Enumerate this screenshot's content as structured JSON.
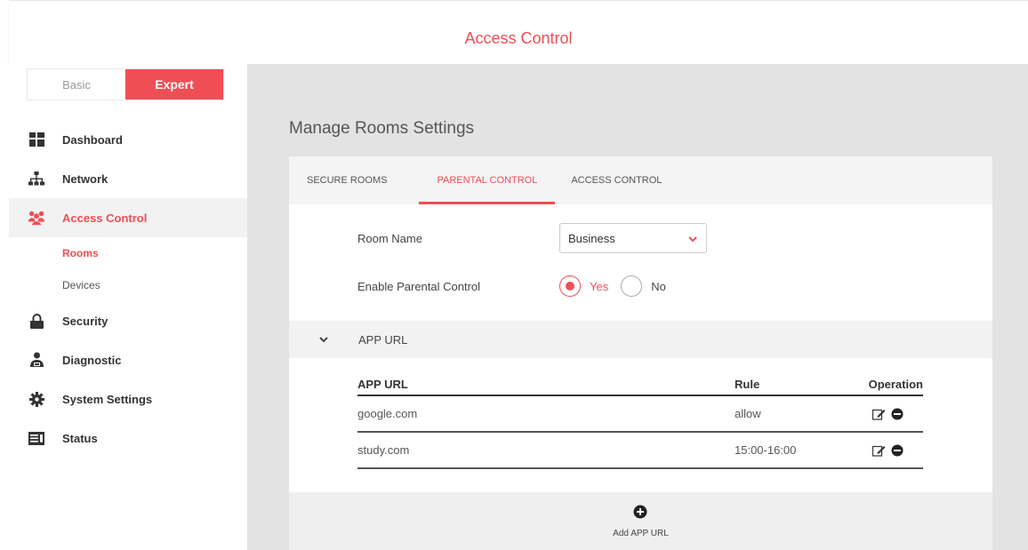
{
  "header": {
    "title": "Access Control"
  },
  "mode_toggle": {
    "basic": "Basic",
    "expert": "Expert",
    "active": "expert"
  },
  "nav": {
    "items": [
      {
        "label": "Dashboard",
        "icon": "dashboard-icon"
      },
      {
        "label": "Network",
        "icon": "network-icon"
      },
      {
        "label": "Access Control",
        "icon": "users-icon",
        "active": true
      },
      {
        "label": "Security",
        "icon": "lock-icon"
      },
      {
        "label": "Diagnostic",
        "icon": "diagnostic-icon"
      },
      {
        "label": "System Settings",
        "icon": "gear-icon"
      },
      {
        "label": "Status",
        "icon": "status-icon"
      }
    ],
    "subitems": [
      {
        "label": "Rooms",
        "active": true
      },
      {
        "label": "Devices"
      }
    ]
  },
  "page": {
    "heading": "Manage Rooms Settings"
  },
  "tabs": [
    {
      "label": "SECURE ROOMS"
    },
    {
      "label": "PARENTAL CONTROL",
      "active": true
    },
    {
      "label": "ACCESS CONTROL"
    }
  ],
  "form": {
    "room_name_label": "Room Name",
    "room_name_value": "Business",
    "enable_label": "Enable Parental Control",
    "yes_label": "Yes",
    "no_label": "No",
    "enabled": "Yes"
  },
  "section": {
    "title": "APP URL"
  },
  "table": {
    "headers": [
      "APP URL",
      "Rule",
      "Operation"
    ],
    "rows": [
      {
        "url": "google.com",
        "rule": "allow"
      },
      {
        "url": "study.com",
        "rule": "15:00-16:00"
      }
    ]
  },
  "footer": {
    "add_label": "Add APP URL"
  },
  "colors": {
    "accent": "#ef4e55",
    "background": "#e3e3e3"
  }
}
